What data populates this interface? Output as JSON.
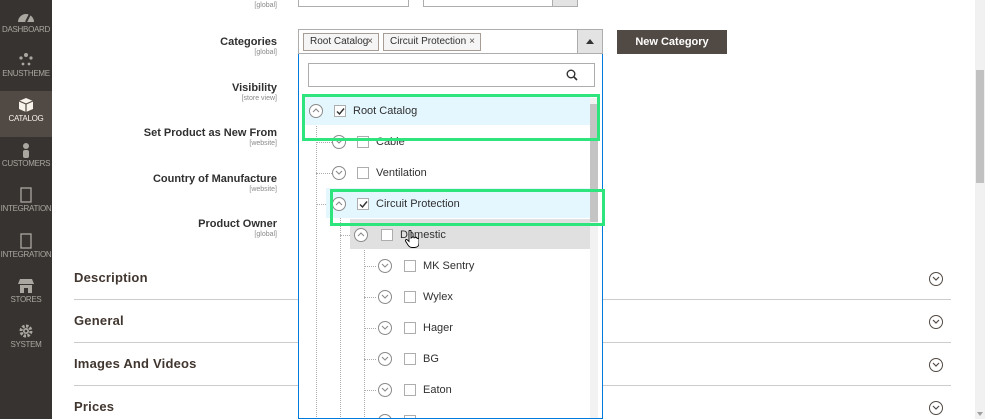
{
  "sidebar": {
    "items": [
      {
        "label": "DASHBOARD",
        "icon": "dashboard-icon",
        "active": false
      },
      {
        "label": "ENUSTHEME",
        "icon": "enustheme-icon",
        "active": false
      },
      {
        "label": "CATALOG",
        "icon": "catalog-box-icon",
        "active": true
      },
      {
        "label": "CUSTOMERS",
        "icon": "customers-icon",
        "active": false
      },
      {
        "label": "INTEGRATION",
        "icon": "integration-icon",
        "active": false
      },
      {
        "label": "INTEGRATION",
        "icon": "integration-icon",
        "active": false
      },
      {
        "label": "STORES",
        "icon": "stores-icon",
        "active": false
      },
      {
        "label": "SYSTEM",
        "icon": "system-gear-icon",
        "active": false
      }
    ]
  },
  "form": {
    "top_scope": "[global]",
    "categories": {
      "label": "Categories",
      "scope": "[global]"
    },
    "visibility": {
      "label": "Visibility",
      "scope": "[store view]"
    },
    "set_new_from": {
      "label": "Set Product as New From",
      "scope": "[website]"
    },
    "country": {
      "label": "Country of Manufacture",
      "scope": "[website]"
    },
    "owner": {
      "label": "Product Owner",
      "scope": "[global]"
    }
  },
  "category_select": {
    "chips": [
      "Root Catalog",
      "Circuit Protection"
    ],
    "chip_remove": "×",
    "new_category_label": "New Category",
    "search_placeholder": ""
  },
  "tree": [
    {
      "label": "Root Catalog",
      "checked": true,
      "expanded": true
    },
    {
      "label": "Cable",
      "checked": false,
      "expanded": false
    },
    {
      "label": "Ventilation",
      "checked": false,
      "expanded": false
    },
    {
      "label": "Circuit Protection",
      "checked": true,
      "expanded": true
    },
    {
      "label": "Domestic",
      "checked": false,
      "expanded": true
    },
    {
      "label": "MK Sentry",
      "checked": false,
      "expanded": false
    },
    {
      "label": "Wylex",
      "checked": false,
      "expanded": false
    },
    {
      "label": "Hager",
      "checked": false,
      "expanded": false
    },
    {
      "label": "BG",
      "checked": false,
      "expanded": false
    },
    {
      "label": "Eaton",
      "checked": false,
      "expanded": false
    }
  ],
  "sections": [
    "Description",
    "General",
    "Images And Videos",
    "Prices"
  ],
  "colors": {
    "sidebar_bg": "#373330",
    "sidebar_active": "#514943",
    "button_bg": "#514943",
    "highlight_row": "#e5f7fe",
    "annotation_green": "#2ee47d",
    "focus_border": "#007bdb"
  }
}
